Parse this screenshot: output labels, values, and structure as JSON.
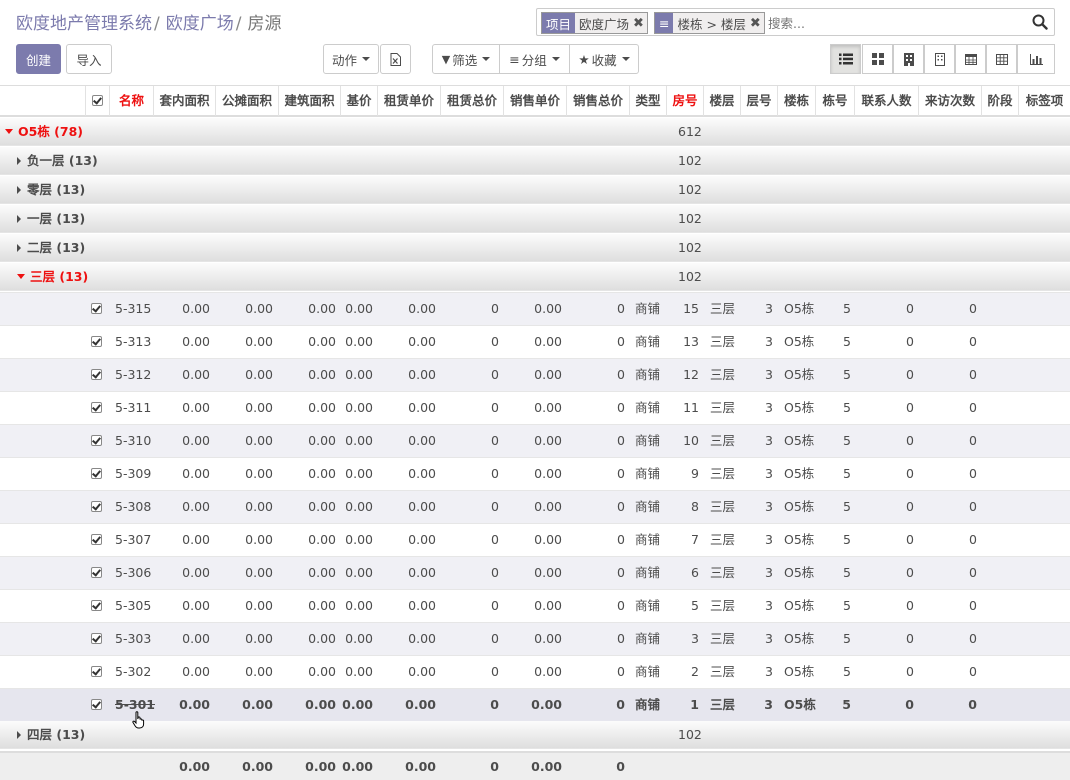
{
  "breadcrumb": {
    "root": "欧度地产管理系统",
    "parent": "欧度广场",
    "current": "房源",
    "sep": "/"
  },
  "search": {
    "facets": [
      {
        "label": "项目",
        "value": "欧度广场"
      },
      {
        "label": "≡",
        "value": "楼栋 > 楼层"
      }
    ],
    "placeholder": "搜索..."
  },
  "toolbar": {
    "create": "创建",
    "import": "导入",
    "action": "动作",
    "filter": "筛选",
    "group": "分组",
    "favorite": "收藏"
  },
  "views": [
    "list-view",
    "kanban-view",
    "form-view",
    "report-view",
    "calendar-view",
    "pivot-view",
    "graph-view"
  ],
  "columns": [
    "名称",
    "套内面积",
    "公摊面积",
    "建筑面积",
    "基价",
    "租赁单价",
    "租赁总价",
    "销售单价",
    "销售总价",
    "类型",
    "房号",
    "楼层",
    "层号",
    "楼栋",
    "栋号",
    "联系人数",
    "来访次数",
    "阶段",
    "标签项"
  ],
  "groups": {
    "top": {
      "label": "O5栋 (78)",
      "count": "612"
    },
    "closed_before": [
      {
        "label": "负一层 (13)",
        "count": "102"
      },
      {
        "label": "零层 (13)",
        "count": "102"
      },
      {
        "label": "一层 (13)",
        "count": "102"
      },
      {
        "label": "二层 (13)",
        "count": "102"
      }
    ],
    "open": {
      "label": "三层 (13)",
      "count": "102"
    },
    "closed_after": [
      {
        "label": "四层 (13)",
        "count": "102"
      }
    ]
  },
  "rows": [
    [
      "5-315",
      "0.00",
      "0.00",
      "0.00",
      "0.00",
      "0.00",
      "0",
      "0.00",
      "0",
      "商铺",
      "15",
      "三层",
      "3",
      "O5栋",
      "5",
      "0",
      "0"
    ],
    [
      "5-313",
      "0.00",
      "0.00",
      "0.00",
      "0.00",
      "0.00",
      "0",
      "0.00",
      "0",
      "商铺",
      "13",
      "三层",
      "3",
      "O5栋",
      "5",
      "0",
      "0"
    ],
    [
      "5-312",
      "0.00",
      "0.00",
      "0.00",
      "0.00",
      "0.00",
      "0",
      "0.00",
      "0",
      "商铺",
      "12",
      "三层",
      "3",
      "O5栋",
      "5",
      "0",
      "0"
    ],
    [
      "5-311",
      "0.00",
      "0.00",
      "0.00",
      "0.00",
      "0.00",
      "0",
      "0.00",
      "0",
      "商铺",
      "11",
      "三层",
      "3",
      "O5栋",
      "5",
      "0",
      "0"
    ],
    [
      "5-310",
      "0.00",
      "0.00",
      "0.00",
      "0.00",
      "0.00",
      "0",
      "0.00",
      "0",
      "商铺",
      "10",
      "三层",
      "3",
      "O5栋",
      "5",
      "0",
      "0"
    ],
    [
      "5-309",
      "0.00",
      "0.00",
      "0.00",
      "0.00",
      "0.00",
      "0",
      "0.00",
      "0",
      "商铺",
      "9",
      "三层",
      "3",
      "O5栋",
      "5",
      "0",
      "0"
    ],
    [
      "5-308",
      "0.00",
      "0.00",
      "0.00",
      "0.00",
      "0.00",
      "0",
      "0.00",
      "0",
      "商铺",
      "8",
      "三层",
      "3",
      "O5栋",
      "5",
      "0",
      "0"
    ],
    [
      "5-307",
      "0.00",
      "0.00",
      "0.00",
      "0.00",
      "0.00",
      "0",
      "0.00",
      "0",
      "商铺",
      "7",
      "三层",
      "3",
      "O5栋",
      "5",
      "0",
      "0"
    ],
    [
      "5-306",
      "0.00",
      "0.00",
      "0.00",
      "0.00",
      "0.00",
      "0",
      "0.00",
      "0",
      "商铺",
      "6",
      "三层",
      "3",
      "O5栋",
      "5",
      "0",
      "0"
    ],
    [
      "5-305",
      "0.00",
      "0.00",
      "0.00",
      "0.00",
      "0.00",
      "0",
      "0.00",
      "0",
      "商铺",
      "5",
      "三层",
      "3",
      "O5栋",
      "5",
      "0",
      "0"
    ],
    [
      "5-303",
      "0.00",
      "0.00",
      "0.00",
      "0.00",
      "0.00",
      "0",
      "0.00",
      "0",
      "商铺",
      "3",
      "三层",
      "3",
      "O5栋",
      "5",
      "0",
      "0"
    ],
    [
      "5-302",
      "0.00",
      "0.00",
      "0.00",
      "0.00",
      "0.00",
      "0",
      "0.00",
      "0",
      "商铺",
      "2",
      "三层",
      "3",
      "O5栋",
      "5",
      "0",
      "0"
    ],
    [
      "5-301",
      "0.00",
      "0.00",
      "0.00",
      "0.00",
      "0.00",
      "0",
      "0.00",
      "0",
      "商铺",
      "1",
      "三层",
      "3",
      "O5栋",
      "5",
      "0",
      "0"
    ]
  ],
  "totals": [
    "0.00",
    "0.00",
    "0.00",
    "0.00",
    "0.00",
    "0",
    "0.00",
    "0"
  ],
  "colors": {
    "accent": "#7c7bad",
    "sorted_header": "#e11111",
    "row_stripe": "#f0f0f5"
  }
}
